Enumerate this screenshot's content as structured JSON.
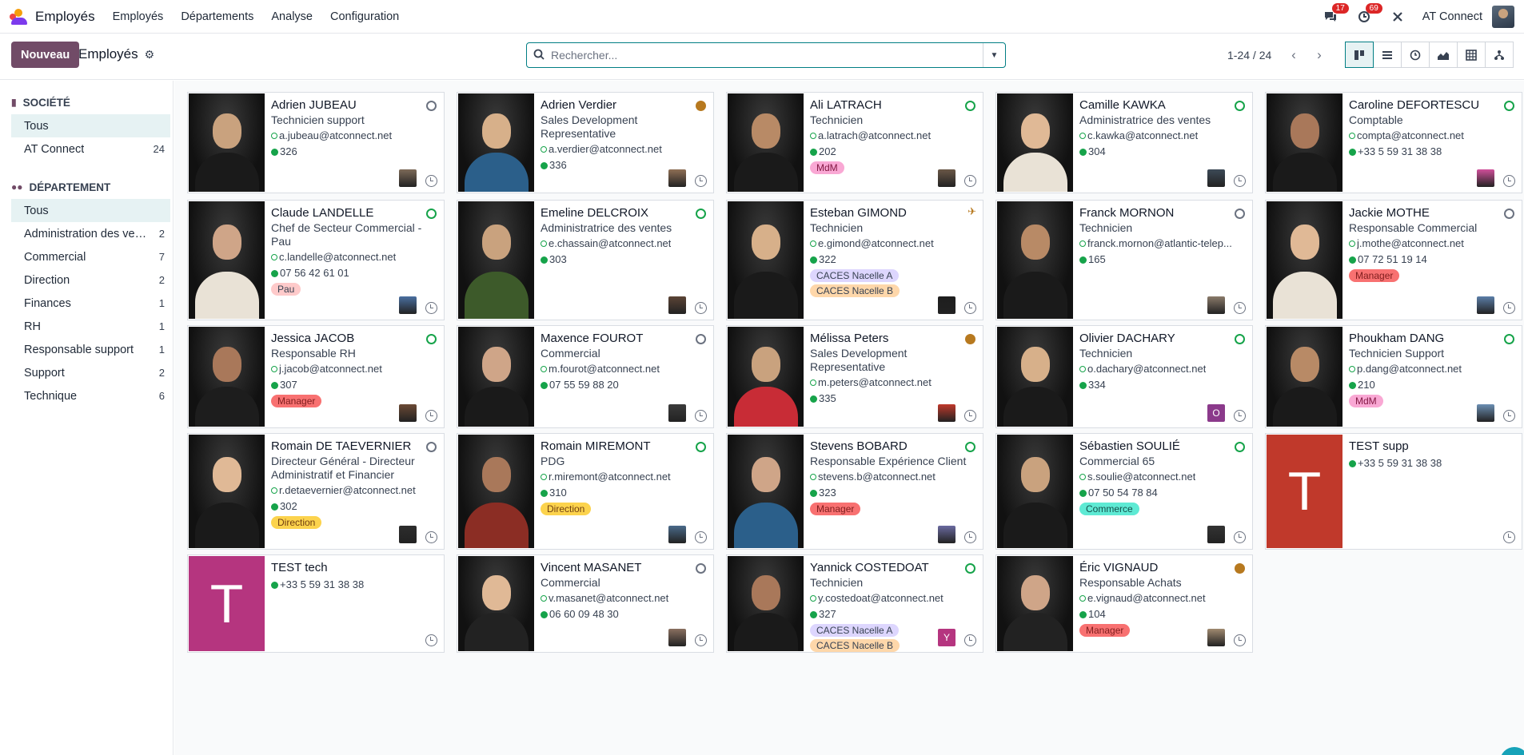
{
  "app": {
    "title": "Employés"
  },
  "nav": {
    "menu": [
      "Employés",
      "Départements",
      "Analyse",
      "Configuration"
    ],
    "messages_count": "17",
    "activities_count": "69",
    "company": "AT Connect"
  },
  "control": {
    "new_label": "Nouveau",
    "breadcrumb": "Employés",
    "search_placeholder": "Rechercher...",
    "pager": "1-24 / 24"
  },
  "sidebar": {
    "company_title": "SOCIÉTÉ",
    "company_items": [
      {
        "label": "Tous",
        "count": ""
      },
      {
        "label": "AT Connect",
        "count": "24"
      }
    ],
    "department_title": "DÉPARTEMENT",
    "department_items": [
      {
        "label": "Tous",
        "count": ""
      },
      {
        "label": "Administration des ventes",
        "count": "2"
      },
      {
        "label": "Commercial",
        "count": "7"
      },
      {
        "label": "Direction",
        "count": "2"
      },
      {
        "label": "Finances",
        "count": "1"
      },
      {
        "label": "RH",
        "count": "1"
      },
      {
        "label": "Responsable support",
        "count": "1"
      },
      {
        "label": "Support",
        "count": "2"
      },
      {
        "label": "Technique",
        "count": "6"
      }
    ]
  },
  "employees": [
    {
      "name": "Adrien JUBEAU",
      "job": "Technicien support",
      "email": "a.jubeau@atconnect.net",
      "phone": "326",
      "tags": [],
      "status": "off"
    },
    {
      "name": "Adrien Verdier",
      "job": "Sales Development Representative",
      "email": "a.verdier@atconnect.net",
      "phone": "336",
      "tags": [],
      "status": "away"
    },
    {
      "name": "Ali LATRACH",
      "job": "Technicien",
      "email": "a.latrach@atconnect.net",
      "phone": "202",
      "tags": [
        "MdM"
      ],
      "status": "on"
    },
    {
      "name": "Camille KAWKA",
      "job": "Administratrice des ventes",
      "email": "c.kawka@atconnect.net",
      "phone": "304",
      "tags": [],
      "status": "on"
    },
    {
      "name": "Caroline DEFORTESCU",
      "job": "Comptable",
      "email": "compta@atconnect.net",
      "phone": "+33 5 59 31 38 38",
      "tags": [],
      "status": "on"
    },
    {
      "name": "Claude LANDELLE",
      "job": "Chef de Secteur Commercial - Pau",
      "email": "c.landelle@atconnect.net",
      "phone": "07 56 42 61 01",
      "tags": [
        "Pau"
      ],
      "status": "on"
    },
    {
      "name": "Emeline DELCROIX",
      "job": "Administratrice des ventes",
      "email": "e.chassain@atconnect.net",
      "phone": "303",
      "tags": [],
      "status": "on"
    },
    {
      "name": "Esteban GIMOND",
      "job": "Technicien",
      "email": "e.gimond@atconnect.net",
      "phone": "322",
      "tags": [
        "CACES Nacelle A",
        "CACES Nacelle B"
      ],
      "status": "plane"
    },
    {
      "name": "Franck MORNON",
      "job": "Technicien",
      "email": "franck.mornon@atlantic-telep...",
      "phone": "165",
      "tags": [],
      "status": "off"
    },
    {
      "name": "Jackie MOTHE",
      "job": "Responsable Commercial",
      "email": "j.mothe@atconnect.net",
      "phone": "07 72 51 19 14",
      "tags": [
        "Manager"
      ],
      "status": "off"
    },
    {
      "name": "Jessica JACOB",
      "job": "Responsable RH",
      "email": "j.jacob@atconnect.net",
      "phone": "307",
      "tags": [
        "Manager"
      ],
      "status": "on"
    },
    {
      "name": "Maxence FOUROT",
      "job": "Commercial",
      "email": "m.fourot@atconnect.net",
      "phone": "07 55 59 88 20",
      "tags": [],
      "status": "off"
    },
    {
      "name": "Mélissa Peters",
      "job": "Sales Development Representative",
      "email": "m.peters@atconnect.net",
      "phone": "335",
      "tags": [],
      "status": "away"
    },
    {
      "name": "Olivier DACHARY",
      "job": "Technicien",
      "email": "o.dachary@atconnect.net",
      "phone": "334",
      "tags": [],
      "status": "on"
    },
    {
      "name": "Phoukham DANG",
      "job": "Technicien Support",
      "email": "p.dang@atconnect.net",
      "phone": "210",
      "tags": [
        "MdM"
      ],
      "status": "on"
    },
    {
      "name": "Romain DE TAEVERNIER",
      "job": "Directeur Général - Directeur Administratif et Financier",
      "email": "r.detaevernier@atconnect.net",
      "phone": "302",
      "tags": [
        "Direction"
      ],
      "status": "off"
    },
    {
      "name": "Romain MIREMONT",
      "job": "PDG",
      "email": "r.miremont@atconnect.net",
      "phone": "310",
      "tags": [
        "Direction"
      ],
      "status": "on"
    },
    {
      "name": "Stevens BOBARD",
      "job": "Responsable Expérience Client",
      "email": "stevens.b@atconnect.net",
      "phone": "323",
      "tags": [
        "Manager"
      ],
      "status": "on"
    },
    {
      "name": "Sébastien SOULIÉ",
      "job": "Commercial 65",
      "email": "s.soulie@atconnect.net",
      "phone": "07 50 54 78 84",
      "tags": [
        "Commerce"
      ],
      "status": "on"
    },
    {
      "name": "TEST supp",
      "job": "",
      "email": "",
      "phone": "+33 5 59 31 38 38",
      "tags": [],
      "status": "none",
      "letter": "T"
    },
    {
      "name": "TEST tech",
      "job": "",
      "email": "",
      "phone": "+33 5 59 31 38 38",
      "tags": [],
      "status": "none",
      "letter": "T"
    },
    {
      "name": "Vincent MASANET",
      "job": "Commercial",
      "email": "v.masanet@atconnect.net",
      "phone": "06 60 09 48 30",
      "tags": [],
      "status": "off"
    },
    {
      "name": "Yannick COSTEDOAT",
      "job": "Technicien",
      "email": "y.costedoat@atconnect.net",
      "phone": "327",
      "tags": [
        "CACES Nacelle A",
        "CACES Nacelle B"
      ],
      "status": "on",
      "manager_letter": "Y"
    },
    {
      "name": "Éric VIGNAUD",
      "job": "Responsable Achats",
      "email": "e.vignaud@atconnect.net",
      "phone": "104",
      "tags": [
        "Manager"
      ],
      "status": "away"
    }
  ],
  "extra": {
    "olivier_manager_letter": "O"
  },
  "colors": {
    "accent": "#714b67",
    "teal": "#017e84",
    "tag_MdM": "#f9a8d4",
    "tag_Pau": "#fecaca",
    "tag_Manager": "#f87171",
    "tag_Direction": "#fcd34d",
    "tag_Commerce": "#5eead4",
    "tag_CACES_A": "#ddd6fe",
    "tag_CACES_B": "#fed7aa"
  },
  "icons": [
    "chat-icon",
    "clock-activity-icon",
    "tools-icon",
    "search-icon",
    "gear-icon",
    "kanban-view-icon",
    "list-view-icon",
    "activity-view-icon",
    "graph-view-icon",
    "pivot-view-icon",
    "hierarchy-view-icon",
    "building-icon",
    "users-icon"
  ]
}
